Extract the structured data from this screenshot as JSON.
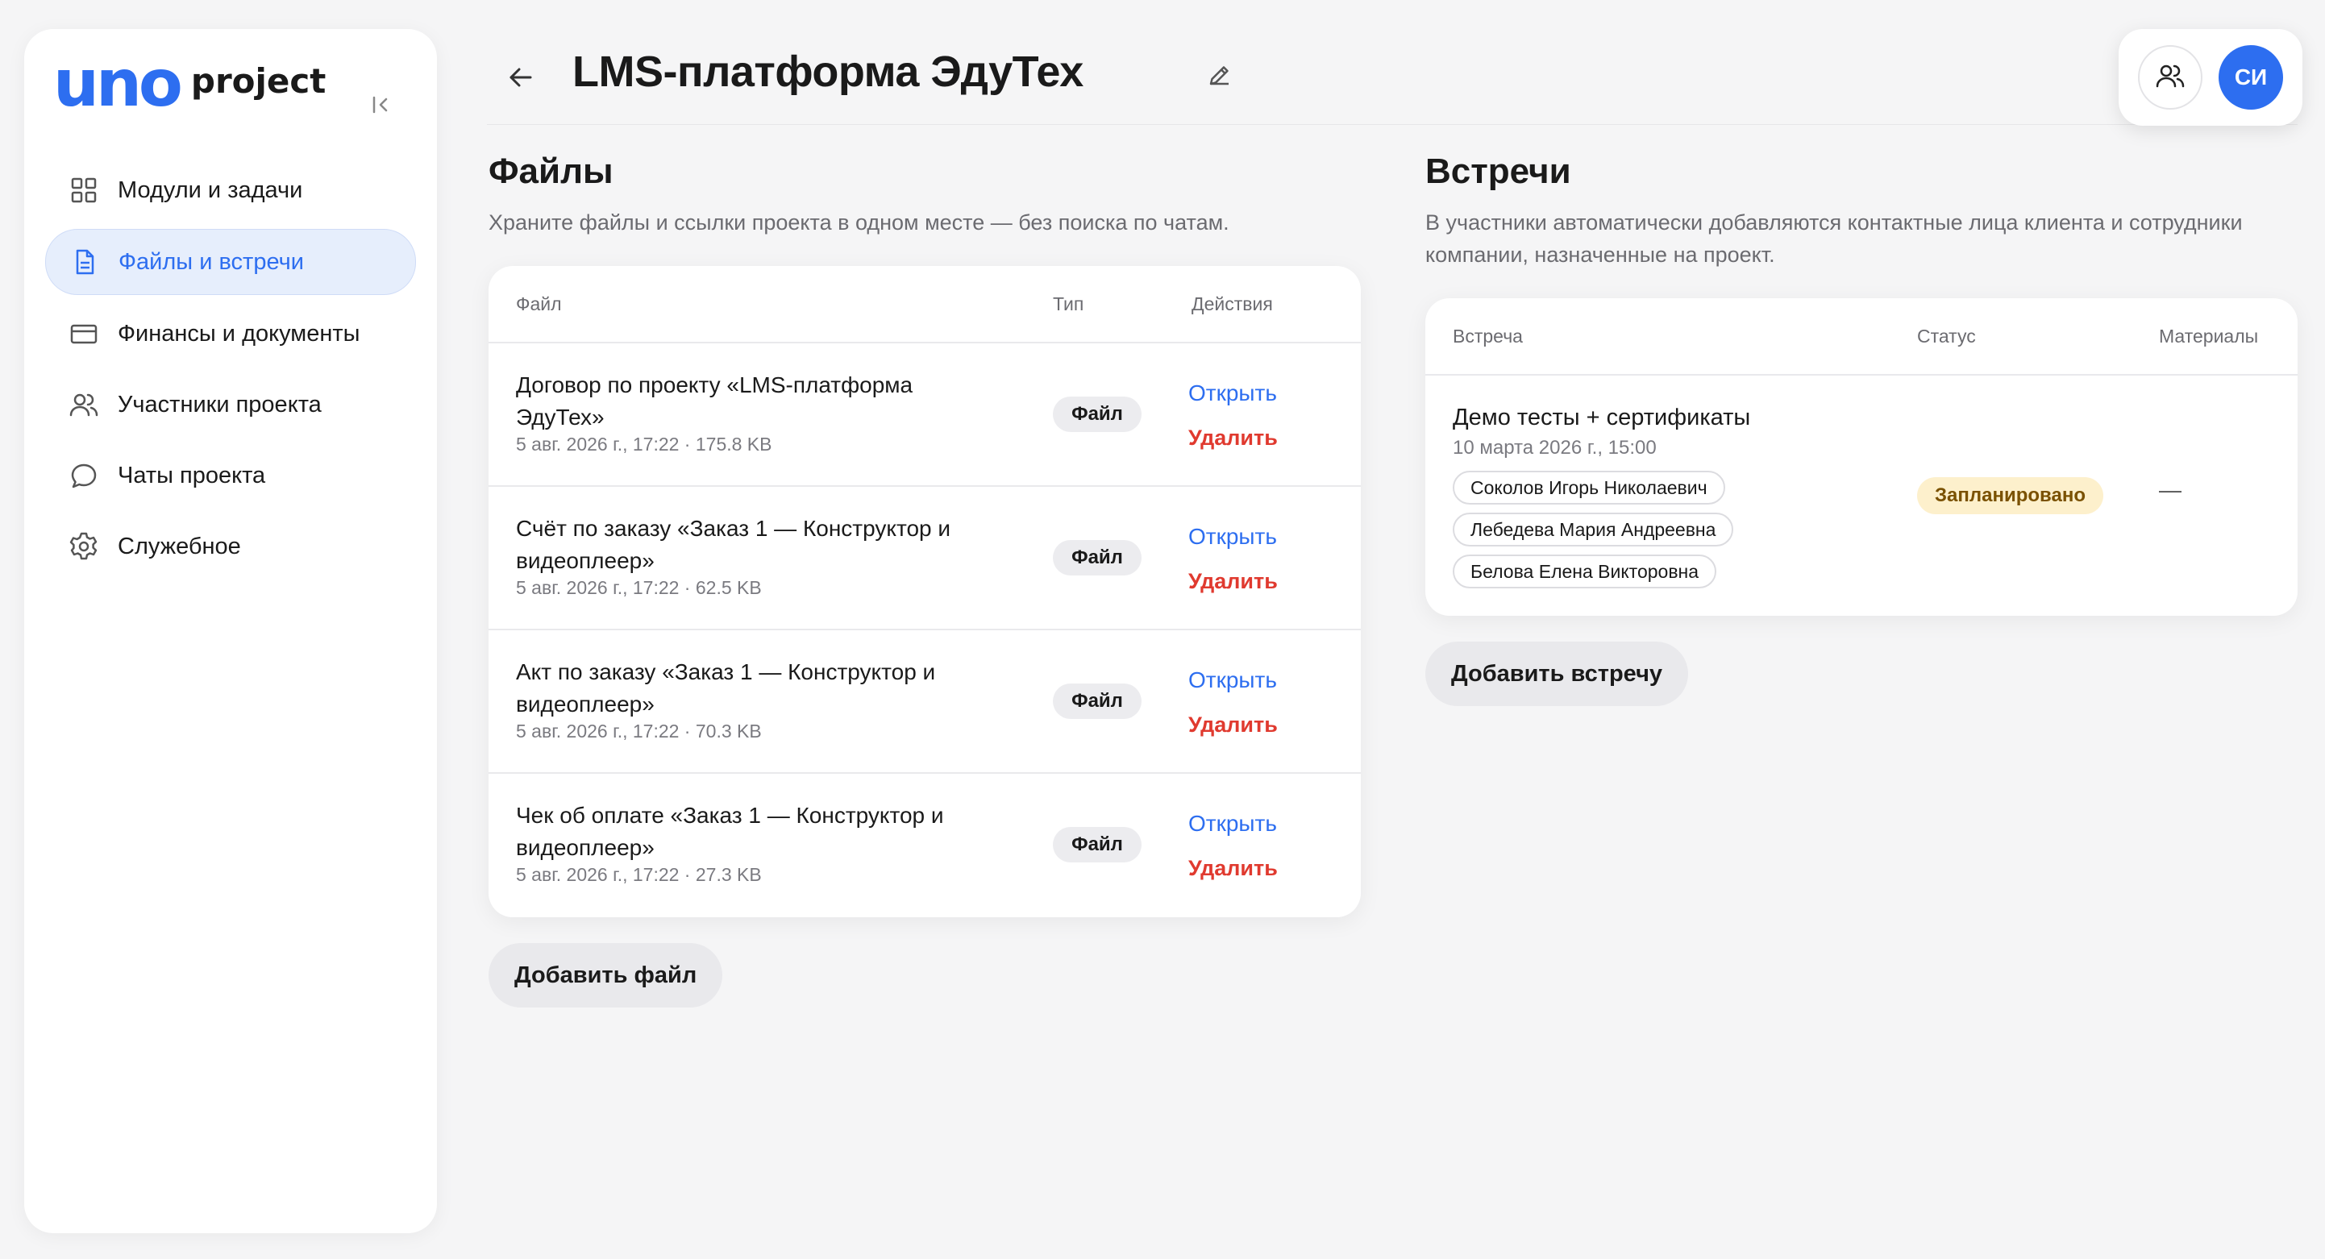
{
  "brand": {
    "logo_main": "uno",
    "logo_sub": "project"
  },
  "sidebar": {
    "items": [
      {
        "label": "Модули и задачи",
        "icon": "grid-icon",
        "active": false
      },
      {
        "label": "Файлы и встречи",
        "icon": "document-icon",
        "active": true
      },
      {
        "label": "Финансы и документы",
        "icon": "card-icon",
        "active": false
      },
      {
        "label": "Участники проекта",
        "icon": "users-icon",
        "active": false
      },
      {
        "label": "Чаты проекта",
        "icon": "chat-icon",
        "active": false
      },
      {
        "label": "Служебное",
        "icon": "gear-icon",
        "active": false
      }
    ]
  },
  "header": {
    "title": "LMS-платформа ЭдуТех",
    "avatar_initials": "СИ"
  },
  "files": {
    "title": "Файлы",
    "description": "Храните файлы и ссылки проекта в одном месте — без поиска по чатам.",
    "columns": [
      "Файл",
      "Тип",
      "Действия"
    ],
    "rows": [
      {
        "name": "Договор по проекту «LMS-платформа ЭдуТех»",
        "meta": "5 авг. 2026 г., 17:22 · 175.8 KB",
        "type": "Файл",
        "open": "Открыть",
        "delete": "Удалить"
      },
      {
        "name": "Счёт по заказу «Заказ 1 — Конструктор и видеоплеер»",
        "meta": "5 авг. 2026 г., 17:22 · 62.5 KB",
        "type": "Файл",
        "open": "Открыть",
        "delete": "Удалить"
      },
      {
        "name": "Акт по заказу «Заказ 1 — Конструктор и видеоплеер»",
        "meta": "5 авг. 2026 г., 17:22 · 70.3 KB",
        "type": "Файл",
        "open": "Открыть",
        "delete": "Удалить"
      },
      {
        "name": "Чек об оплате «Заказ 1 — Конструктор и видеоплеер»",
        "meta": "5 авг. 2026 г., 17:22 · 27.3 KB",
        "type": "Файл",
        "open": "Открыть",
        "delete": "Удалить"
      }
    ],
    "add_label": "Добавить файл"
  },
  "meetings": {
    "title": "Встречи",
    "description": "В участники автоматически добавляются контактные лица клиента и сотрудники компании, назначенные на проект.",
    "columns": [
      "Встреча",
      "Статус",
      "Материалы"
    ],
    "rows": [
      {
        "title": "Демо тесты + сертификаты",
        "date": "10 марта 2026 г., 15:00",
        "participants": [
          "Соколов Игорь Николаевич",
          "Лебедева Мария Андреевна",
          "Белова Елена Викторовна"
        ],
        "status": "Запланировано",
        "materials": "—"
      }
    ],
    "add_label": "Добавить встречу"
  },
  "colors": {
    "accent": "#2d6ef0",
    "danger": "#e03a2f",
    "status_bg": "#fdf0cc"
  }
}
